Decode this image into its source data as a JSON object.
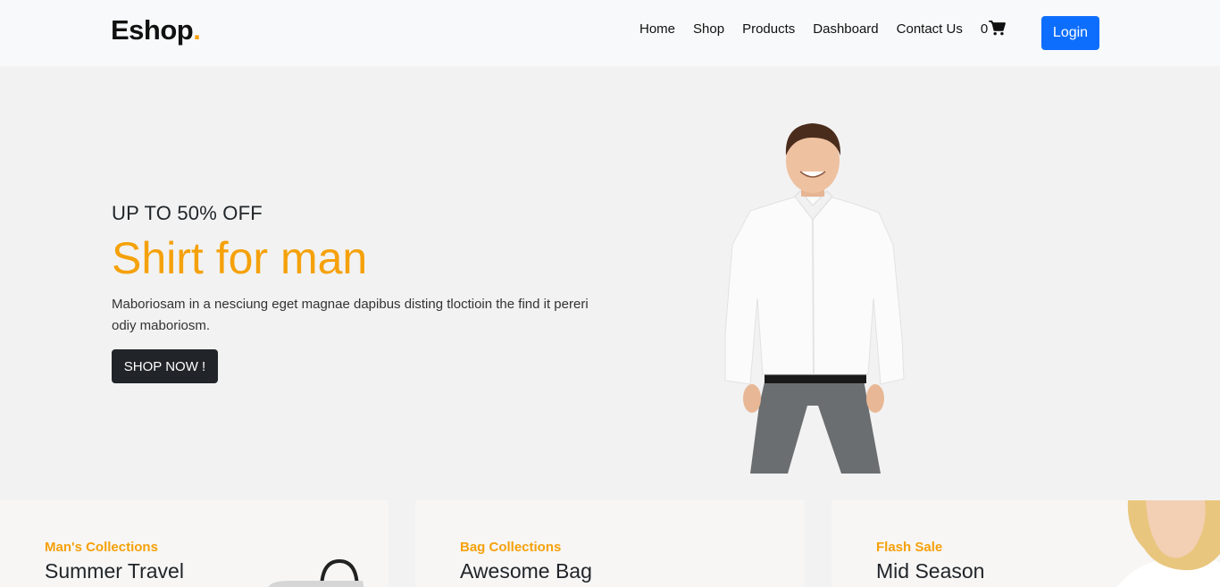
{
  "brand": {
    "name": "Eshop",
    "dot": ".",
    "accent": "#f5a10a"
  },
  "nav": {
    "links": [
      "Home",
      "Shop",
      "Products",
      "Dashboard",
      "Contact Us"
    ],
    "cart_count": "0",
    "cart_icon": "cart-icon",
    "login_label": "Login",
    "login_color": "#0d6efd"
  },
  "hero": {
    "subtitle": "UP TO 50% OFF",
    "title": "Shirt for man",
    "description": "Maboriosam in a nesciung eget magnae dapibus disting tloctioin the find it pereri odiy maboriosm.",
    "button_label": "SHOP NOW !",
    "image": "man-in-white-shirt"
  },
  "collections": [
    {
      "category": "Man's Collections",
      "title": "Summer Travel",
      "image": "bag-image"
    },
    {
      "category": "Bag Collections",
      "title": "Awesome Bag",
      "image": ""
    },
    {
      "category": "Flash Sale",
      "title": "Mid Season",
      "image": "woman-image"
    }
  ]
}
